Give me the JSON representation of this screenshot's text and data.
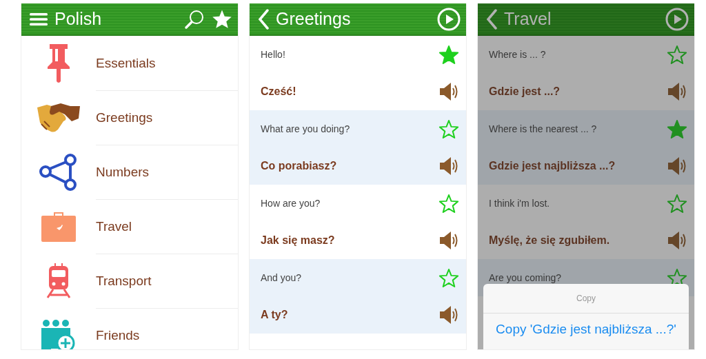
{
  "screens": [
    {
      "kind": "menu",
      "title": "Polish",
      "categories": [
        "Essentials",
        "Greetings",
        "Numbers",
        "Travel",
        "Transport",
        "Friends"
      ]
    },
    {
      "kind": "phrases",
      "title": "Greetings",
      "dimmed": false,
      "phrases": [
        {
          "english": "Hello!",
          "polish": "Cześć!",
          "starred": true
        },
        {
          "english": "What are you doing?",
          "polish": "Co porabiasz?",
          "starred": false
        },
        {
          "english": "How are you?",
          "polish": "Jak się masz?",
          "starred": false
        },
        {
          "english": "And you?",
          "polish": "A ty?",
          "starred": false
        }
      ]
    },
    {
      "kind": "phrases",
      "title": "Travel",
      "dimmed": true,
      "phrases": [
        {
          "english": "Where is ... ?",
          "polish": "Gdzie jest ...?",
          "starred": false
        },
        {
          "english": "Where is the nearest ... ?",
          "polish": "Gdzie jest najbliższa ...?",
          "starred": true
        },
        {
          "english": "I think i'm lost.",
          "polish": "Myślę, że się zgubiłem.",
          "starred": false
        },
        {
          "english": "Are you coming?",
          "starred": false
        }
      ],
      "action_sheet": {
        "title": "Copy",
        "action": "Copy 'Gdzie jest najbliższa ...?'"
      }
    }
  ]
}
